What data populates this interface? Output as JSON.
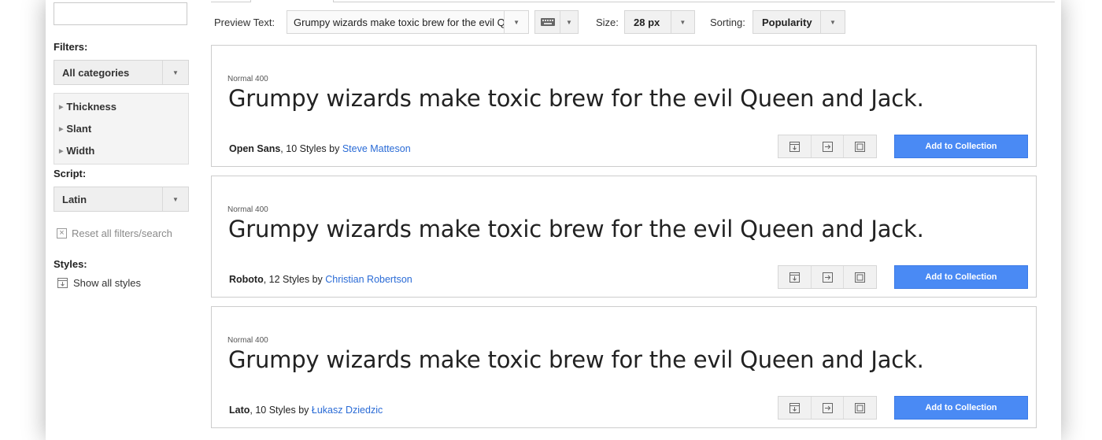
{
  "sidebar": {
    "search_value": "",
    "filters_label": "Filters:",
    "category": "All categories",
    "filter_items": [
      "Thickness",
      "Slant",
      "Width"
    ],
    "script_label": "Script:",
    "script_value": "Latin",
    "reset_label": "Reset all filters/search",
    "styles_label": "Styles:",
    "show_styles_label": "Show all styles"
  },
  "toolbar": {
    "preview_label": "Preview Text:",
    "preview_value": "Grumpy wizards make toxic brew for the evil Queen and Jack.",
    "size_label": "Size:",
    "size_value": "28 px",
    "sorting_label": "Sorting:",
    "sorting_value": "Popularity"
  },
  "cards": [
    {
      "style": "Normal 400",
      "preview": "Grumpy wizards make toxic brew for the evil Queen and Jack.",
      "font": "Open Sans",
      "styles_text": ", 10 Styles by ",
      "designer": "Steve Matteson",
      "add_label": "Add to Collection"
    },
    {
      "style": "Normal 400",
      "preview": "Grumpy wizards make toxic brew for the evil Queen and Jack.",
      "font": "Roboto",
      "styles_text": ", 12 Styles by ",
      "designer": "Christian Robertson",
      "add_label": "Add to Collection"
    },
    {
      "style": "Normal 400",
      "preview": "Grumpy wizards make toxic brew for the evil Queen and Jack.",
      "font": "Lato",
      "styles_text": ", 10 Styles by ",
      "designer": "Łukasz Dziedzic",
      "add_label": "Add to Collection"
    }
  ],
  "colors": {
    "accent": "#4a8af4",
    "link": "#2a6bd6"
  },
  "icons": [
    "dropdown-arrow-icon",
    "keyboard-icon",
    "caret-right-icon",
    "close-box-icon",
    "download-icon",
    "export-icon",
    "copy-icon"
  ]
}
